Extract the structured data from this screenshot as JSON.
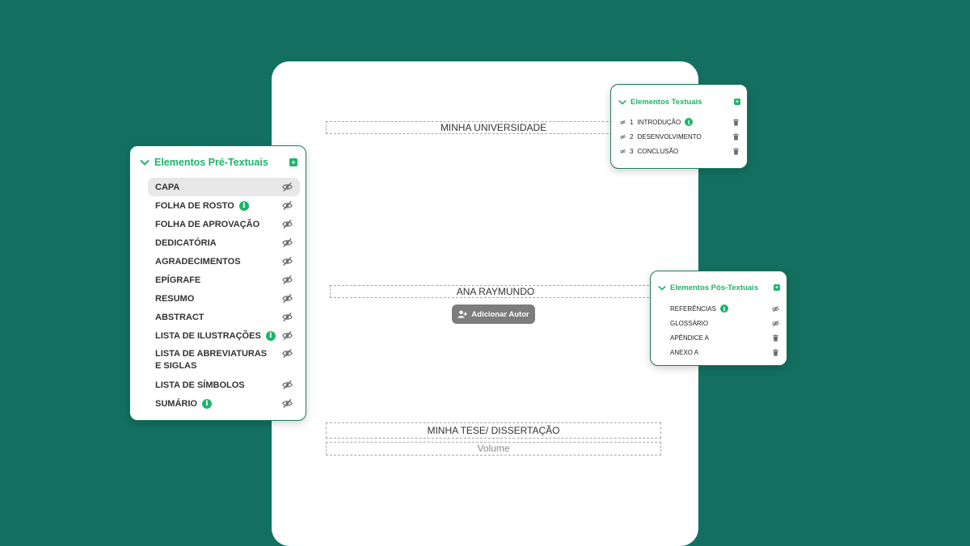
{
  "colors": {
    "background": "#137060",
    "accent": "#1fb36b",
    "card_border": "#1e7a60",
    "button": "#7d7d7d"
  },
  "document": {
    "university": "MINHA UNIVERSIDADE",
    "author": "ANA RAYMUNDO",
    "add_author_label": "Adicionar Autor",
    "title": "MINHA TESE/ DISSERTAÇÃO",
    "volume": "Volume"
  },
  "pre_textual": {
    "title": "Elementos Pré-Textuais",
    "items": [
      {
        "label": "CAPA",
        "info": false,
        "icon": "eye-off-icon",
        "selected": true
      },
      {
        "label": "FOLHA DE ROSTO",
        "info": true,
        "icon": "eye-off-icon"
      },
      {
        "label": "FOLHA DE APROVAÇÃO",
        "info": false,
        "icon": "eye-off-icon"
      },
      {
        "label": "DEDICATÓRIA",
        "info": false,
        "icon": "eye-off-icon"
      },
      {
        "label": "AGRADECIMENTOS",
        "info": false,
        "icon": "eye-off-icon"
      },
      {
        "label": "EPÍGRAFE",
        "info": false,
        "icon": "eye-off-icon"
      },
      {
        "label": "RESUMO",
        "info": false,
        "icon": "eye-off-icon"
      },
      {
        "label": "ABSTRACT",
        "info": false,
        "icon": "eye-off-icon"
      },
      {
        "label": "LISTA DE ILUSTRAÇÕES",
        "info": true,
        "icon": "eye-off-icon"
      },
      {
        "label": "LISTA DE ABREVIATURAS E SIGLAS",
        "info": false,
        "icon": "eye-off-icon"
      },
      {
        "label": "LISTA DE SÍMBOLOS",
        "info": false,
        "icon": "eye-off-icon"
      },
      {
        "label": "SUMÁRIO",
        "info": true,
        "icon": "eye-off-icon"
      }
    ]
  },
  "textual": {
    "title": "Elementos Textuais",
    "items": [
      {
        "number": "1",
        "label": "INTRODUÇÃO",
        "info": true,
        "icon": "trash-icon"
      },
      {
        "number": "2",
        "label": "DESENVOLVIMENTO",
        "info": false,
        "icon": "trash-icon"
      },
      {
        "number": "3",
        "label": "CONCLUSÃO",
        "info": false,
        "icon": "trash-icon"
      }
    ]
  },
  "post_textual": {
    "title": "Elementos Pós-Textuais",
    "items": [
      {
        "label": "REFERÊNCIAS",
        "info": true,
        "icon": "eye-off-icon"
      },
      {
        "label": "GLOSSÁRIO",
        "info": false,
        "icon": "eye-off-icon"
      },
      {
        "label": "APÊNDICE A",
        "info": false,
        "icon": "trash-icon"
      },
      {
        "label": "ANEXO A",
        "info": false,
        "icon": "trash-icon"
      }
    ]
  }
}
